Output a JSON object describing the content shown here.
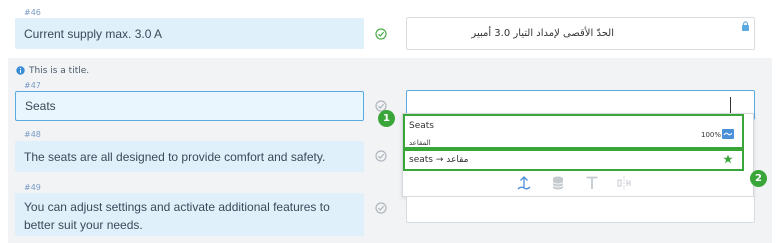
{
  "segments": [
    {
      "id": "#46",
      "source": "Current supply max. 3.0 A",
      "target": "الحدّ الأقصى لإمداد التيار 3.0 أمبير"
    },
    {
      "id": "#47",
      "source": "Seats",
      "target": ""
    },
    {
      "id": "#48",
      "source": "The seats are all designed to provide comfort and safety.",
      "target": ""
    },
    {
      "id": "#49",
      "source": "You can adjust settings and activate additional features to better suit your needs.",
      "target": ""
    }
  ],
  "info": {
    "text": "This is a title."
  },
  "suggestions": {
    "tm_source": "Seats",
    "tm_match": "100%",
    "tm_target": "المقاعد",
    "termbase_entry": "seats → مقاعد"
  },
  "callouts": [
    "1",
    "2"
  ],
  "colors": {
    "accent": "#5aa9e0",
    "highlight": "#3aa639",
    "source_bg": "#dff0fa"
  }
}
